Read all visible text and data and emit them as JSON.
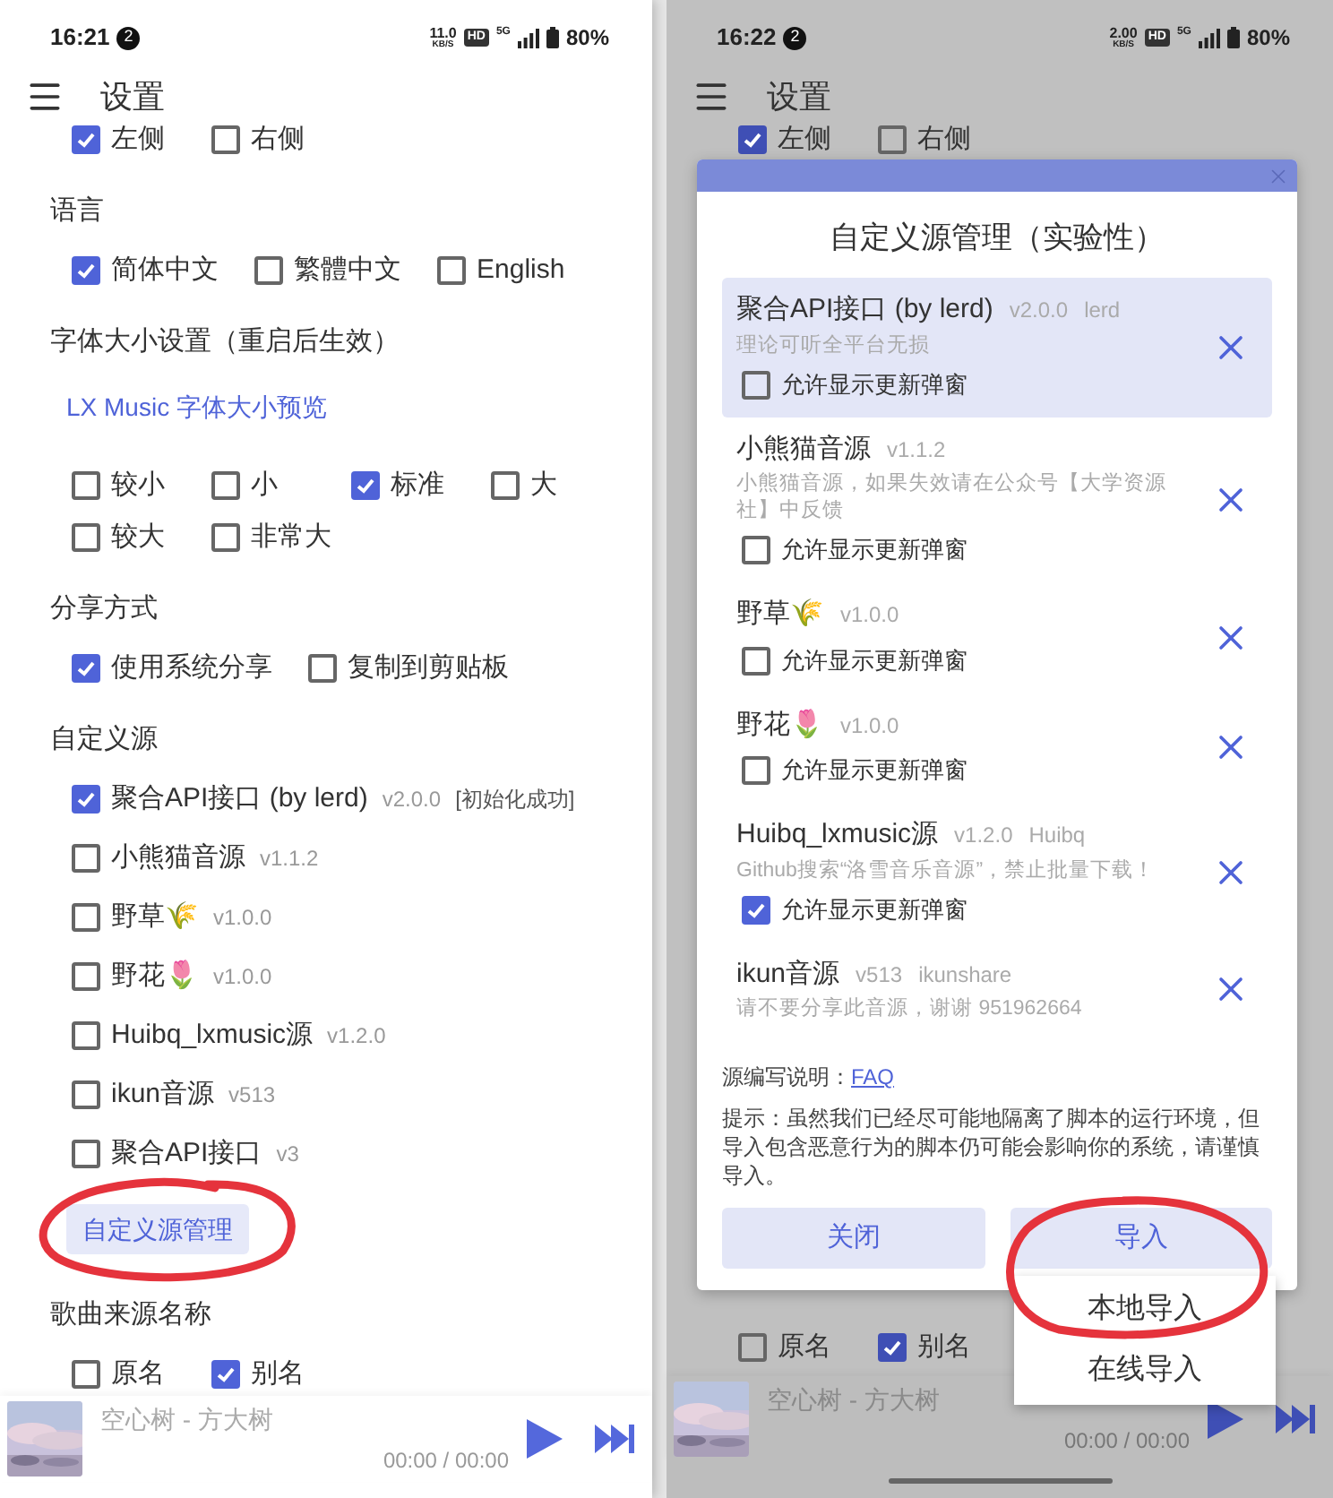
{
  "left_screen": {
    "status_bar": {
      "time": "16:21",
      "notification_count": "2",
      "speed": "11.0",
      "speed_unit": "KB/S",
      "hd_badge": "HD",
      "network": "5G",
      "battery": "80%"
    },
    "title": "设置",
    "sections": [
      {
        "kind": "row",
        "options": [
          {
            "label": "左侧",
            "checked": true
          },
          {
            "label": "右侧",
            "checked": false
          }
        ]
      },
      {
        "heading": "语言",
        "kind": "row",
        "options": [
          {
            "label": "简体中文",
            "checked": true
          },
          {
            "label": "繁體中文",
            "checked": false
          },
          {
            "label": "English",
            "checked": false
          }
        ]
      },
      {
        "heading": "字体大小设置（重启后生效）",
        "preview": "LX Music 字体大小预览",
        "kind": "row",
        "options": [
          {
            "label": "较小",
            "checked": false
          },
          {
            "label": "小",
            "checked": false
          },
          {
            "label": "标准",
            "checked": true
          },
          {
            "label": "大",
            "checked": false
          },
          {
            "label": "较大",
            "checked": false
          },
          {
            "label": "非常大",
            "checked": false
          }
        ]
      },
      {
        "heading": "分享方式",
        "kind": "row",
        "options": [
          {
            "label": "使用系统分享",
            "checked": true
          },
          {
            "label": "复制到剪贴板",
            "checked": false
          }
        ]
      },
      {
        "heading": "自定义源",
        "kind": "list",
        "options": [
          {
            "label": "聚合API接口 (by lerd)",
            "version": "v2.0.0",
            "status": "[初始化成功]",
            "checked": true
          },
          {
            "label": "小熊猫音源",
            "version": "v1.1.2",
            "checked": false
          },
          {
            "label": "野草🌾",
            "version": "v1.0.0",
            "checked": false
          },
          {
            "label": "野花🌷",
            "version": "v1.0.0",
            "checked": false
          },
          {
            "label": "Huibq_lxmusic源",
            "version": "v1.2.0",
            "checked": false
          },
          {
            "label": "ikun音源",
            "version": "v513",
            "checked": false
          },
          {
            "label": "聚合API接口",
            "version": "v3",
            "checked": false
          }
        ],
        "button": "自定义源管理"
      },
      {
        "heading": "歌曲来源名称",
        "kind": "row",
        "options": [
          {
            "label": "原名",
            "checked": false
          },
          {
            "label": "别名",
            "checked": true
          }
        ]
      }
    ],
    "player": {
      "track": "空心树 - 方大树",
      "time": "00:00 / 00:00"
    }
  },
  "right_screen": {
    "status_bar": {
      "time": "16:22",
      "notification_count": "2",
      "speed": "2.00",
      "speed_unit": "KB/S",
      "hd_badge": "HD",
      "network": "5G",
      "battery": "80%"
    },
    "title": "设置",
    "top_options": [
      {
        "label": "左侧",
        "checked": true
      },
      {
        "label": "右侧",
        "checked": false
      }
    ],
    "bottom_options": [
      {
        "label": "原名",
        "checked": false
      },
      {
        "label": "别名",
        "checked": true
      }
    ],
    "player": {
      "track": "空心树 - 方大树",
      "time": "00:00 / 00:00"
    },
    "dialog": {
      "title": "自定义源管理（实验性）",
      "sources": [
        {
          "name": "聚合API接口 (by lerd)",
          "version": "v2.0.0",
          "author": "lerd",
          "description": "理论可听全平台无损",
          "selected": true,
          "popup": {
            "label": "允许显示更新弹窗",
            "checked": false
          }
        },
        {
          "name": "小熊猫音源",
          "version": "v1.1.2",
          "description": "小熊猫音源，如果失效请在公众号【大学资源社】中反馈",
          "selected": false,
          "popup": {
            "label": "允许显示更新弹窗",
            "checked": false
          }
        },
        {
          "name": "野草🌾",
          "version": "v1.0.0",
          "selected": false,
          "popup": {
            "label": "允许显示更新弹窗",
            "checked": false
          }
        },
        {
          "name": "野花🌷",
          "version": "v1.0.0",
          "selected": false,
          "popup": {
            "label": "允许显示更新弹窗",
            "checked": false
          }
        },
        {
          "name": "Huibq_lxmusic源",
          "version": "v1.2.0",
          "author": "Huibq",
          "description": "Github搜索“洛雪音乐音源”，禁止批量下载！",
          "selected": false,
          "popup": {
            "label": "允许显示更新弹窗",
            "checked": true
          }
        },
        {
          "name": "ikun音源",
          "version": "v513",
          "author": "ikunshare",
          "description": "请不要分享此音源，谢谢 951962664",
          "selected": false
        }
      ],
      "doc_label": "源编写说明：",
      "doc_link": "FAQ",
      "tip": "提示：虽然我们已经尽可能地隔离了脚本的运行环境，但导入包含恶意行为的脚本仍可能会影响你的系统，请谨慎导入。",
      "buttons": [
        "关闭",
        "导入"
      ],
      "menu": [
        "本地导入",
        "在线导入"
      ]
    }
  }
}
